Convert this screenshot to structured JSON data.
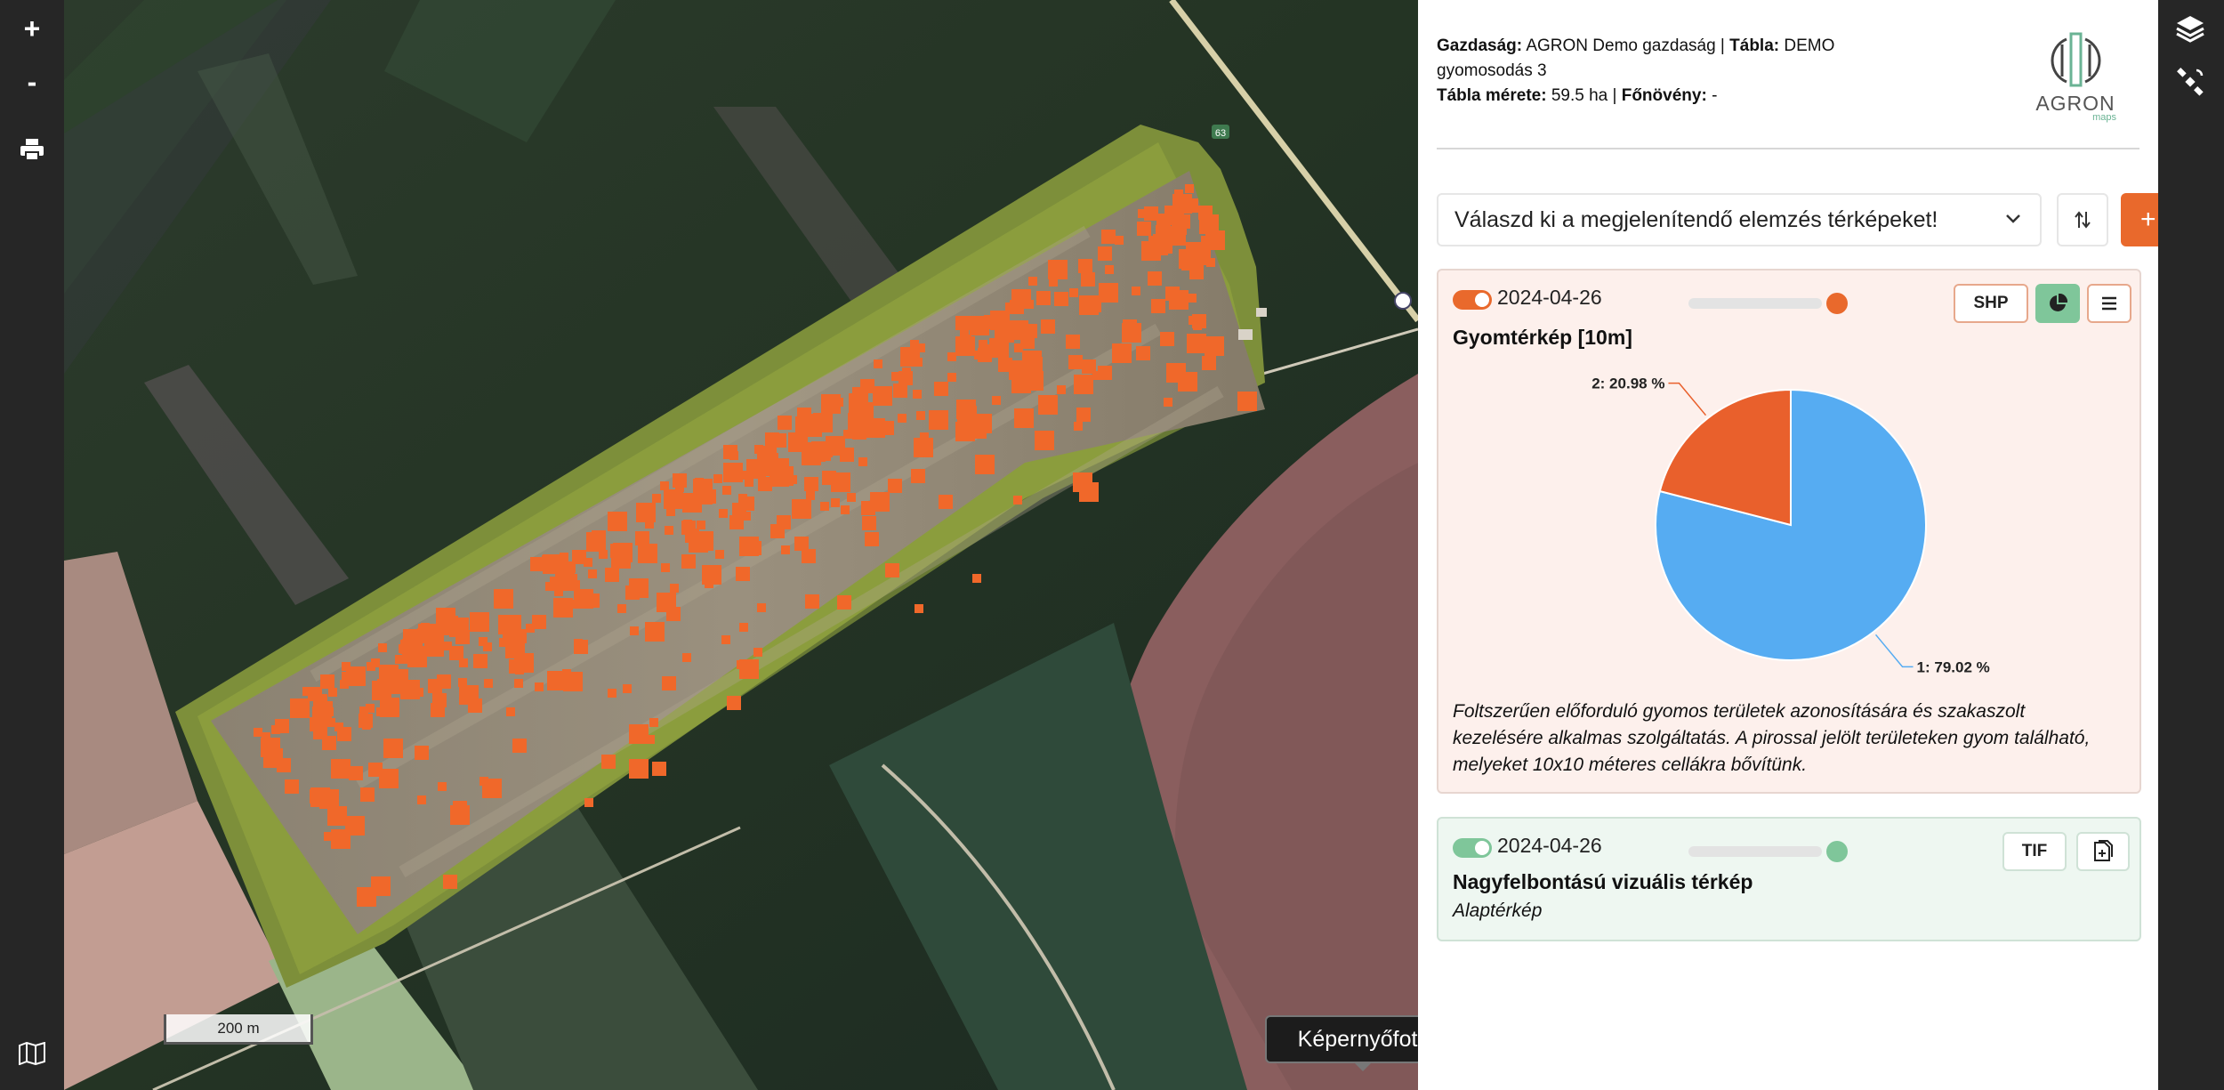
{
  "map": {
    "zoom_in": "+",
    "zoom_out": "-",
    "scale_label": "200 m",
    "road_number": "63",
    "screenshot_label": "Képernyőfotó"
  },
  "header": {
    "farm_label": "Gazdaság:",
    "farm_value": "AGRON Demo gazdaság |",
    "field_label": "Tábla:",
    "field_value": "DEMO gyomosodás 3",
    "size_label": "Tábla mérete:",
    "size_value": "59.5 ha |",
    "crop_label": "Főnövény:",
    "crop_value": "-",
    "logo_text": "AGRON",
    "logo_sub": "maps"
  },
  "selector": {
    "placeholder": "Válaszd ki a megjelenítendő elemzés térképeket!",
    "add_label": "+"
  },
  "layers": [
    {
      "date": "2024-04-26",
      "title": "Gyomtérkép [10m]",
      "button": "SHP",
      "enabled": true,
      "opacity": 1.0,
      "toggle_color": "#e9692c",
      "description": "Foltszerűen előforduló gyomos területek azonosítására és szakaszolt kezelésére alkalmas szolgáltatás. A pirossal jelölt területeken gyom található, melyeket 10x10 méteres cellákra bővítünk."
    },
    {
      "date": "2024-04-26",
      "title": "Nagyfelbontású vizuális térkép",
      "button": "TIF",
      "enabled": true,
      "opacity": 1.0,
      "toggle_color": "#7fc69a",
      "subtitle": "Alaptérkép"
    }
  ],
  "chart_data": {
    "type": "pie",
    "slices": [
      {
        "label": "1: 79.02 %",
        "value": 79.02,
        "color": "#56acf2"
      },
      {
        "label": "2: 20.98 %",
        "value": 20.98,
        "color": "#e9602c"
      }
    ]
  }
}
